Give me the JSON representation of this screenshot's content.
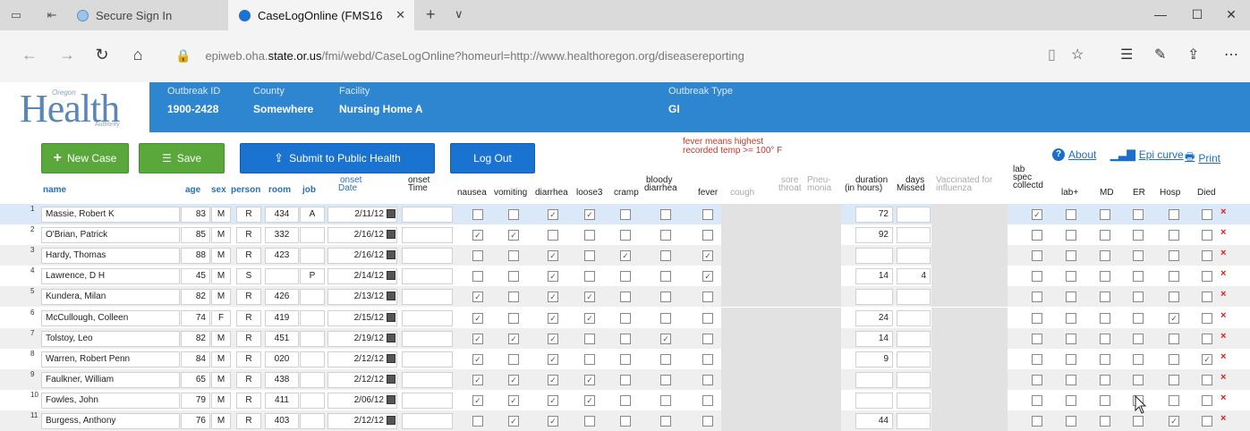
{
  "browser": {
    "tab1_title": "Secure Sign In",
    "tab2_title": "CaseLogOnline (FMS16",
    "url_prefix": "epiweb.oha.",
    "url_domain": "state.or.us",
    "url_path": "/fmi/webd/CaseLogOnline?homeurl=http://www.healthoregon.org/diseasereporting"
  },
  "logo": {
    "text": "Health",
    "small1": "Oregon",
    "small2": "Authority"
  },
  "header": {
    "outbreak_id_label": "Outbreak ID",
    "outbreak_id": "1900-2428",
    "county_label": "County",
    "county": "Somewhere",
    "facility_label": "Facility",
    "facility": "Nursing Home A",
    "type_label": "Outbreak Type",
    "type": "GI"
  },
  "toolbar": {
    "new_case": "New Case",
    "save": "Save",
    "submit": "Submit to Public Health",
    "logout": "Log Out",
    "fever_note_1": "fever means highest",
    "fever_note_2": "recorded temp >= 100° F",
    "about": "About",
    "epi": "Epi curve",
    "print": "Print"
  },
  "columns": {
    "name": "name",
    "age": "age",
    "sex": "sex",
    "person": "person",
    "room": "room",
    "job": "job",
    "onset_date_1": "onset",
    "onset_date_2": "Date",
    "onset_time_1": "onset",
    "onset_time_2": "Time",
    "nausea": "nausea",
    "vomiting": "vomiting",
    "diarrhea": "diarrhea",
    "loose3": "loose3",
    "cramp": "cramp",
    "bloody_1": "bloody",
    "bloody_2": "diarrhea",
    "fever": "fever",
    "cough": "cough",
    "sore_1": "sore",
    "sore_2": "throat",
    "pneu_1": "Pneu-",
    "pneu_2": "monia",
    "duration_1": "duration",
    "duration_2": "(in hours)",
    "days_1": "days",
    "days_2": "Missed",
    "vacc_1": "Vaccinated for",
    "vacc_2": "influenza",
    "lab_1": "lab",
    "lab_2": "spec",
    "lab_3": "collectd",
    "labplus": "lab+",
    "md": "MD",
    "er": "ER",
    "hosp": "Hosp",
    "died": "Died"
  },
  "rows": [
    {
      "n": "1",
      "name": "Massie, Robert K",
      "age": "83",
      "sex": "M",
      "person": "R",
      "room": "434",
      "job": "A",
      "date": "2/11/12",
      "duration": "72",
      "days": "",
      "checks": [
        0,
        0,
        1,
        1,
        0,
        0,
        0
      ],
      "lab": [
        1,
        0,
        0,
        0,
        0,
        0
      ]
    },
    {
      "n": "2",
      "name": "O'Brian, Patrick",
      "age": "85",
      "sex": "M",
      "person": "R",
      "room": "332",
      "job": "",
      "date": "2/16/12",
      "duration": "92",
      "days": "",
      "checks": [
        1,
        1,
        0,
        0,
        0,
        0,
        0
      ],
      "lab": [
        0,
        0,
        0,
        0,
        0,
        0
      ]
    },
    {
      "n": "3",
      "name": "Hardy, Thomas",
      "age": "88",
      "sex": "M",
      "person": "R",
      "room": "423",
      "job": "",
      "date": "2/16/12",
      "duration": "",
      "days": "",
      "checks": [
        0,
        0,
        1,
        0,
        1,
        0,
        1
      ],
      "lab": [
        0,
        0,
        0,
        0,
        0,
        0
      ]
    },
    {
      "n": "4",
      "name": "Lawrence, D H",
      "age": "45",
      "sex": "M",
      "person": "S",
      "room": "",
      "job": "P",
      "date": "2/14/12",
      "duration": "14",
      "days": "4",
      "checks": [
        0,
        0,
        1,
        0,
        0,
        0,
        1
      ],
      "lab": [
        0,
        0,
        0,
        0,
        0,
        0
      ]
    },
    {
      "n": "5",
      "name": "Kundera, Milan",
      "age": "82",
      "sex": "M",
      "person": "R",
      "room": "426",
      "job": "",
      "date": "2/13/12",
      "duration": "",
      "days": "",
      "checks": [
        1,
        0,
        1,
        1,
        0,
        0,
        0
      ],
      "lab": [
        0,
        0,
        0,
        0,
        0,
        0
      ]
    },
    {
      "n": "6",
      "name": "McCullough, Colleen",
      "age": "74",
      "sex": "F",
      "person": "R",
      "room": "419",
      "job": "",
      "date": "2/15/12",
      "duration": "24",
      "days": "",
      "checks": [
        1,
        0,
        1,
        1,
        0,
        0,
        0
      ],
      "lab": [
        0,
        0,
        0,
        0,
        1,
        0
      ]
    },
    {
      "n": "7",
      "name": "Tolstoy, Leo",
      "age": "82",
      "sex": "M",
      "person": "R",
      "room": "451",
      "job": "",
      "date": "2/19/12",
      "duration": "14",
      "days": "",
      "checks": [
        1,
        1,
        1,
        0,
        0,
        1,
        0
      ],
      "lab": [
        0,
        0,
        0,
        0,
        0,
        0
      ]
    },
    {
      "n": "8",
      "name": "Warren, Robert Penn",
      "age": "84",
      "sex": "M",
      "person": "R",
      "room": "020",
      "job": "",
      "date": "2/12/12",
      "duration": "9",
      "days": "",
      "checks": [
        1,
        0,
        1,
        0,
        0,
        0,
        0
      ],
      "lab": [
        0,
        0,
        0,
        0,
        0,
        1
      ]
    },
    {
      "n": "9",
      "name": "Faulkner, William",
      "age": "65",
      "sex": "M",
      "person": "R",
      "room": "438",
      "job": "",
      "date": "2/12/12",
      "duration": "",
      "days": "",
      "checks": [
        1,
        1,
        1,
        1,
        0,
        0,
        0
      ],
      "lab": [
        0,
        0,
        0,
        0,
        0,
        0
      ]
    },
    {
      "n": "10",
      "name": "Fowles, John",
      "age": "79",
      "sex": "M",
      "person": "R",
      "room": "411",
      "job": "",
      "date": "2/06/12",
      "duration": "",
      "days": "",
      "checks": [
        1,
        1,
        1,
        1,
        0,
        0,
        0
      ],
      "lab": [
        0,
        0,
        0,
        0,
        0,
        0
      ]
    },
    {
      "n": "11",
      "name": "Burgess, Anthony",
      "age": "76",
      "sex": "M",
      "person": "R",
      "room": "403",
      "job": "",
      "date": "2/12/12",
      "duration": "44",
      "days": "",
      "checks": [
        0,
        1,
        1,
        0,
        0,
        0,
        0
      ],
      "lab": [
        0,
        0,
        0,
        0,
        1,
        0
      ]
    }
  ],
  "icons": {
    "delete": "×",
    "check": "✓"
  }
}
